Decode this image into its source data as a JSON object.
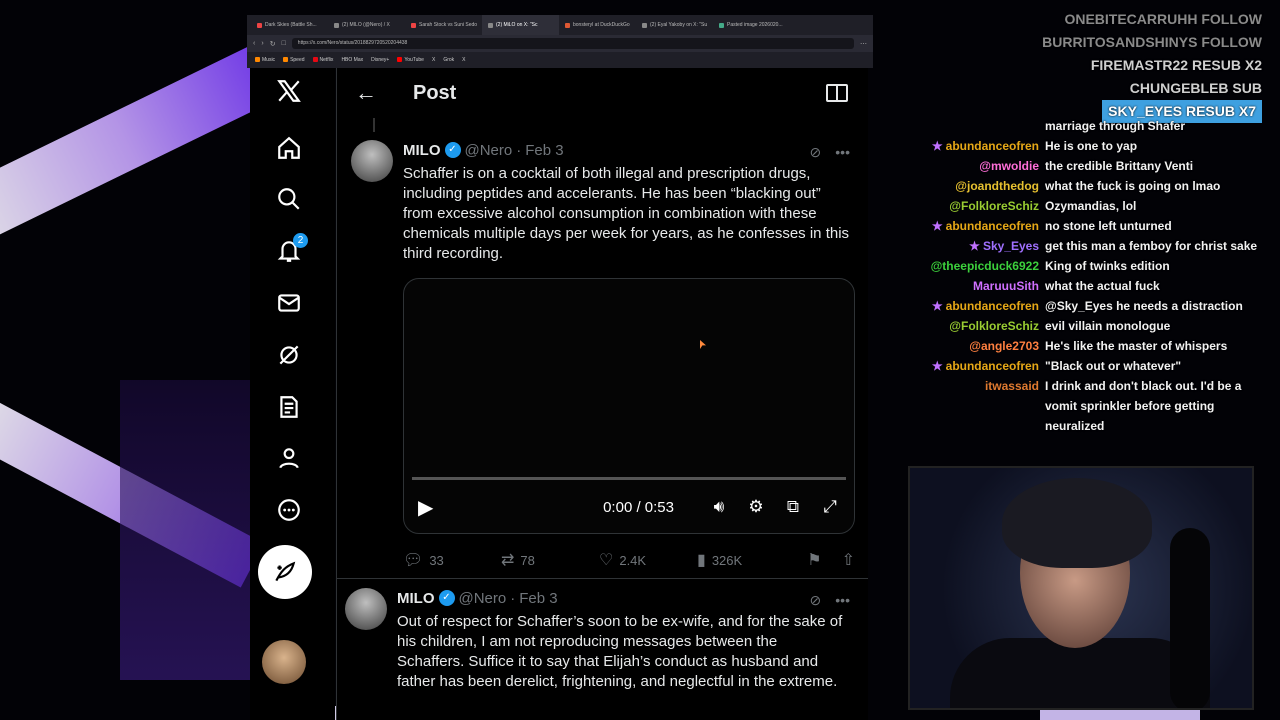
{
  "browser": {
    "tabs": [
      "Dark Skies (Battle Sh...",
      "(2) MILO (@Nero) / X",
      "Sarah Stock vs Suni Sedo",
      "(2) MiLO on X: \"Sc",
      "bonsteryl at DuckDuckGo",
      "(2) Eyal Yakoby on X: \"Su",
      "Pasted image 2026020...",
      ""
    ],
    "url": "https://x.com/Nero/status/2018829720520204438",
    "bookmarks": [
      "Music",
      "Speed",
      "Netflix",
      "HBO Max",
      "Disney+",
      "YouTube",
      "X",
      "Grok",
      "X",
      ""
    ]
  },
  "nav": {
    "notifications_count": "2"
  },
  "header": {
    "title": "Post"
  },
  "tweets": [
    {
      "name": "MILO",
      "handle": "@Nero",
      "sep": "·",
      "date": "Feb 3",
      "text": "Schaffer is on a cocktail of both illegal and prescription drugs, including peptides and accelerants. He has been “blacking out” from excessive alcohol consumption in combination with these chemicals multiple days per week for years, as he confesses in this third recording.",
      "video_time": "0:00 / 0:53",
      "video_progress": 0,
      "replies": "33",
      "reposts": "78",
      "likes": "2.4K",
      "views": "326K"
    },
    {
      "name": "MILO",
      "handle": "@Nero",
      "sep": "·",
      "date": "Feb 3",
      "text": "Out of respect for Schaffer’s soon to be ex-wife, and for the sake of his children, I am not reproducing messages between the Schaffers. Suffice it to say that Elijah’s conduct as husband and father has been derelict, frightening, and neglectful in the extreme."
    }
  ],
  "events": [
    {
      "text": "ONEBITECARRUHH  FOLLOW",
      "style": "dim"
    },
    {
      "text": "BURRITOSANDSHINYS  FOLLOW",
      "style": "dim"
    },
    {
      "text": "FIREMASTR22  RESUB X2",
      "style": "normal"
    },
    {
      "text": "CHUNGEBLEB  SUB",
      "style": "normal"
    },
    {
      "text": "SKY_EYES  RESUB X7",
      "style": "hl"
    }
  ],
  "chat": [
    {
      "user": "",
      "msg": "marriage through Shafer",
      "color": "#ffffff",
      "badge": false
    },
    {
      "user": "abundanceofren",
      "msg": "He is one to yap",
      "color": "#e6a817",
      "badge": true
    },
    {
      "user": "@mwoldie",
      "msg": "the credible Brittany Venti",
      "color": "#ff6fd8",
      "badge": false
    },
    {
      "user": "@joandthedog",
      "msg": "what the fuck is going on lmao",
      "color": "#e6c030",
      "badge": false
    },
    {
      "user": "@FolkloreSchiz",
      "msg": "Ozymandias, lol",
      "color": "#9acd32",
      "badge": false
    },
    {
      "user": "abundanceofren",
      "msg": "no stone left unturned",
      "color": "#e6a817",
      "badge": true
    },
    {
      "user": "Sky_Eyes",
      "msg": "get this man a femboy for christ sake",
      "color": "#a070ff",
      "badge": true
    },
    {
      "user": "@theepicduck6922",
      "msg": "King of twinks edition",
      "color": "#3cd03c",
      "badge": false
    },
    {
      "user": "MaruuuSith",
      "msg": "what the actual fuck",
      "color": "#d070ff",
      "badge": false
    },
    {
      "user": "abundanceofren",
      "msg": "@Sky_Eyes he needs a distraction",
      "color": "#e6a817",
      "badge": true
    },
    {
      "user": "@FolkloreSchiz",
      "msg": "evil villain monologue",
      "color": "#9acd32",
      "badge": false
    },
    {
      "user": "@angle2703",
      "msg": "He's like the master of whispers",
      "color": "#ff8040",
      "badge": false
    },
    {
      "user": "abundanceofren",
      "msg": "\"Black out or whatever\"",
      "color": "#e6a817",
      "badge": true
    },
    {
      "user": "itwassaid",
      "msg": "I drink and don't black out. I'd be a vomit sprinkler before getting neuralized",
      "color": "#e07a30",
      "badge": false
    }
  ]
}
